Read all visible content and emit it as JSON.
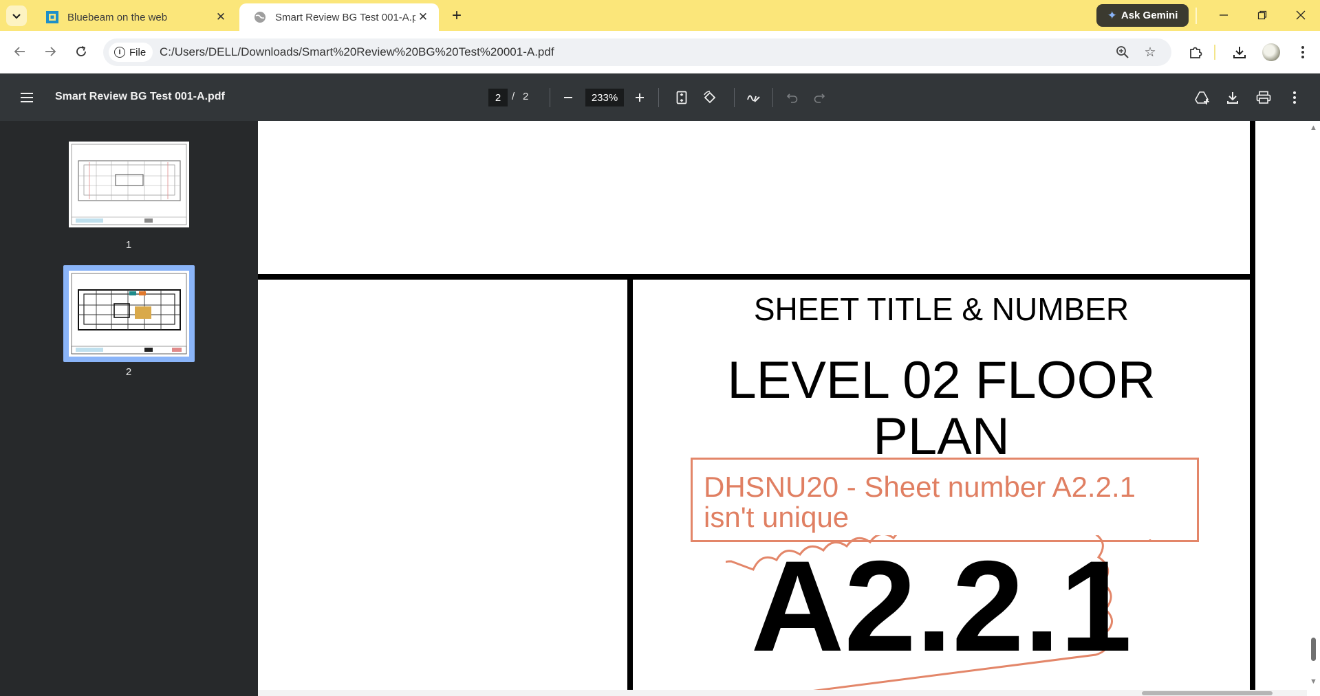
{
  "browser": {
    "tabs": [
      {
        "title": "Bluebeam on the web",
        "active": false
      },
      {
        "title": "Smart Review BG Test 001-A.pdf",
        "active": true
      }
    ],
    "gemini_label": "Ask Gemini",
    "address": {
      "chip_label": "File",
      "url": "C:/Users/DELL/Downloads/Smart%20Review%20BG%20Test%20001-A.pdf"
    },
    "colors": {
      "tab_strip": "#fbe67a",
      "gemini_bg": "#3b3a30"
    }
  },
  "viewer": {
    "doc_title": "Smart Review BG Test 001-A.pdf",
    "current_page": "2",
    "page_separator": "/",
    "total_pages": "2",
    "zoom": "233%",
    "thumbnails": [
      {
        "label": "1",
        "selected": false
      },
      {
        "label": "2",
        "selected": true
      }
    ],
    "colors": {
      "toolbar": "#323639",
      "sidebar": "#27292b",
      "selection": "#8ab4f8"
    }
  },
  "sheet": {
    "heading": "SHEET TITLE & NUMBER",
    "title_line1": "LEVEL 02 FLOOR",
    "title_line2": "PLAN",
    "markup_line1": "DHSNU20 - Sheet number A2.2.1",
    "markup_line2": "isn't unique",
    "sheet_number": "A2.2.1",
    "colors": {
      "markup": "#e07f62"
    }
  }
}
